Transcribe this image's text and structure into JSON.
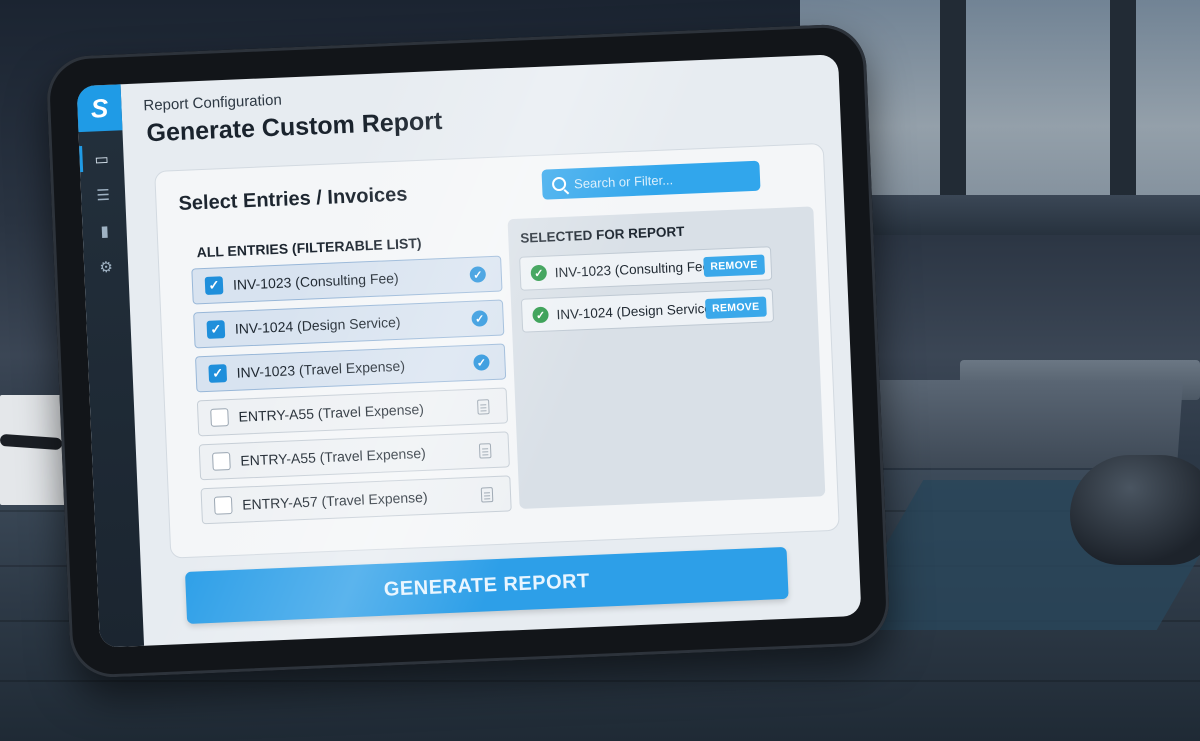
{
  "app": {
    "logo_glyph": "S",
    "accent_color": "#1f9be6"
  },
  "rail": {
    "items": [
      {
        "icon": "dashboard-icon",
        "glyph": "▭"
      },
      {
        "icon": "list-icon",
        "glyph": "☰"
      },
      {
        "icon": "chart-icon",
        "glyph": "▮"
      },
      {
        "icon": "gear-icon",
        "glyph": "⚙"
      }
    ]
  },
  "header": {
    "breadcrumb": "Report Configuration",
    "title": "Generate Custom Report"
  },
  "panel": {
    "title": "Select Entries / Invoices",
    "search": {
      "placeholder": "Search or Filter..."
    }
  },
  "all_entries": {
    "heading": "ALL ENTRIES (FILTERABLE LIST)",
    "items": [
      {
        "label": "INV-1023 (Consulting Fee)",
        "checked": true
      },
      {
        "label": "INV-1024 (Design Service)",
        "checked": true
      },
      {
        "label": "INV-1023 (Travel Expense)",
        "checked": true
      },
      {
        "label": "ENTRY-A55 (Travel Expense)",
        "checked": false
      },
      {
        "label": "ENTRY-A55 (Travel Expense)",
        "checked": false
      },
      {
        "label": "ENTRY-A57 (Travel Expense)",
        "checked": false
      }
    ]
  },
  "selected": {
    "heading": "SELECTED FOR REPORT",
    "items": [
      {
        "label": "INV-1023 (Consulting Fee)",
        "action": "REMOVE"
      },
      {
        "label": "INV-1024 (Design Service)",
        "action": "REMOVE"
      }
    ]
  },
  "footer": {
    "generate_label": "GENERATE REPORT"
  }
}
